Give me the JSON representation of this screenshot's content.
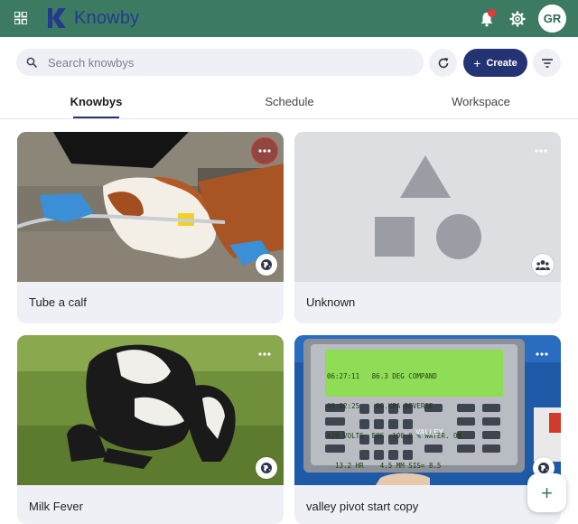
{
  "app": {
    "name": "Knowby",
    "logo_letter": "K",
    "user_initials": "GR",
    "brand_color": "#3d7a62",
    "accent_color": "#243373"
  },
  "header": {
    "icons": [
      "apps-grid-icon",
      "bell-icon",
      "gear-icon"
    ],
    "notification_dot": true
  },
  "toolbar": {
    "search_placeholder": "Search knowbys",
    "create_label": "Create",
    "create_icon": "+"
  },
  "tabs": [
    {
      "label": "Knowbys",
      "active": true
    },
    {
      "label": "Schedule",
      "active": false
    },
    {
      "label": "Workspace",
      "active": false
    }
  ],
  "cards": [
    {
      "title": "Tube a calf",
      "image": "calf-tubing-photo",
      "visibility_icon": "globe-icon"
    },
    {
      "title": "Unknown",
      "image": "placeholder-shapes",
      "visibility_icon": "group-icon"
    },
    {
      "title": "Milk Fever",
      "image": "cow-lying-photo",
      "visibility_icon": "globe-icon"
    },
    {
      "title": "valley pivot start copy",
      "image": "pivot-control-panel-photo",
      "visibility_icon": "globe-icon"
    }
  ],
  "panel": {
    "lines": [
      "06:27:11   86.3 DEG COMPAND",
      "09:02:25    89.KPA REVERSE",
      "429 VOLTS  EOS  100.0 % WATER. ON",
      "  13.2 HR    4.5 MM SIS= 8.5"
    ],
    "brand": "VALLEY"
  },
  "fab_label": "+"
}
